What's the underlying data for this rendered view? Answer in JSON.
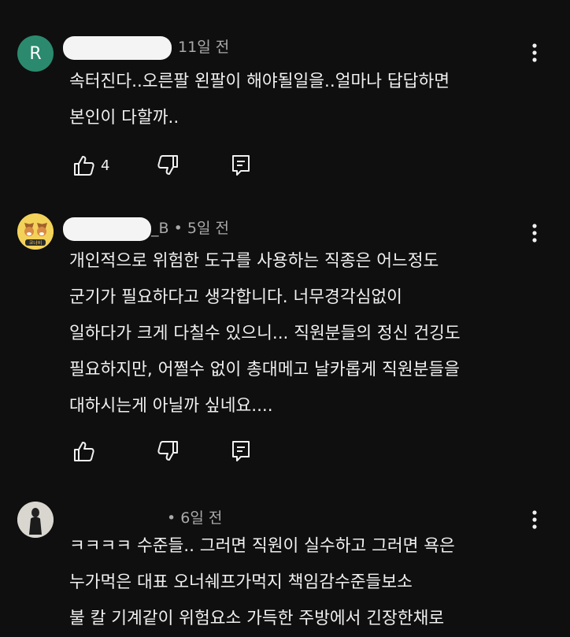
{
  "comments": [
    {
      "avatar_letter": "R",
      "author": "",
      "time": "11일 전",
      "lines": [
        "속터진다..오른팔 왼팔이 해야될일을..얼마나 답답하면",
        "본인이 다할까.."
      ],
      "likes": "4",
      "avatar_color": "#2b8a6e"
    },
    {
      "author_suffix": "_B",
      "sep": "•",
      "time": "5일 전",
      "avatar_badge_text": "코너비",
      "lines": [
        "개인적으로 위험한 도구를 사용하는 직종은 어느정도",
        "군기가 필요하다고 생각합니다. 너무경각심없이",
        "일하다가 크게 다칠수 있으니... 직원분들의 정신 건깅도",
        "필요하지만, 어쩔수 없이 총대메고 날카롭게 직원분들을",
        "대하시는게 아닐까 싶네요...."
      ],
      "likes": ""
    },
    {
      "sep": "•",
      "time": "6일 전",
      "lines": [
        "ㅋㅋㅋㅋ 수준들.. 그러면 직원이 실수하고 그러면 욕은",
        "누가먹은 대표 오너쉐프가먹지 책임감수준들보소",
        "불 칼 기계같이 위험요소 가득한 주방에서 긴장한채로"
      ]
    }
  ],
  "icons": {
    "like": "thumb-up-icon",
    "dislike": "thumb-down-icon",
    "reply": "reply-icon",
    "more": "more-vert-icon"
  },
  "colors": {
    "background": "#0f0f0f",
    "text": "#f1f1f1",
    "meta": "#aaaaaa"
  }
}
